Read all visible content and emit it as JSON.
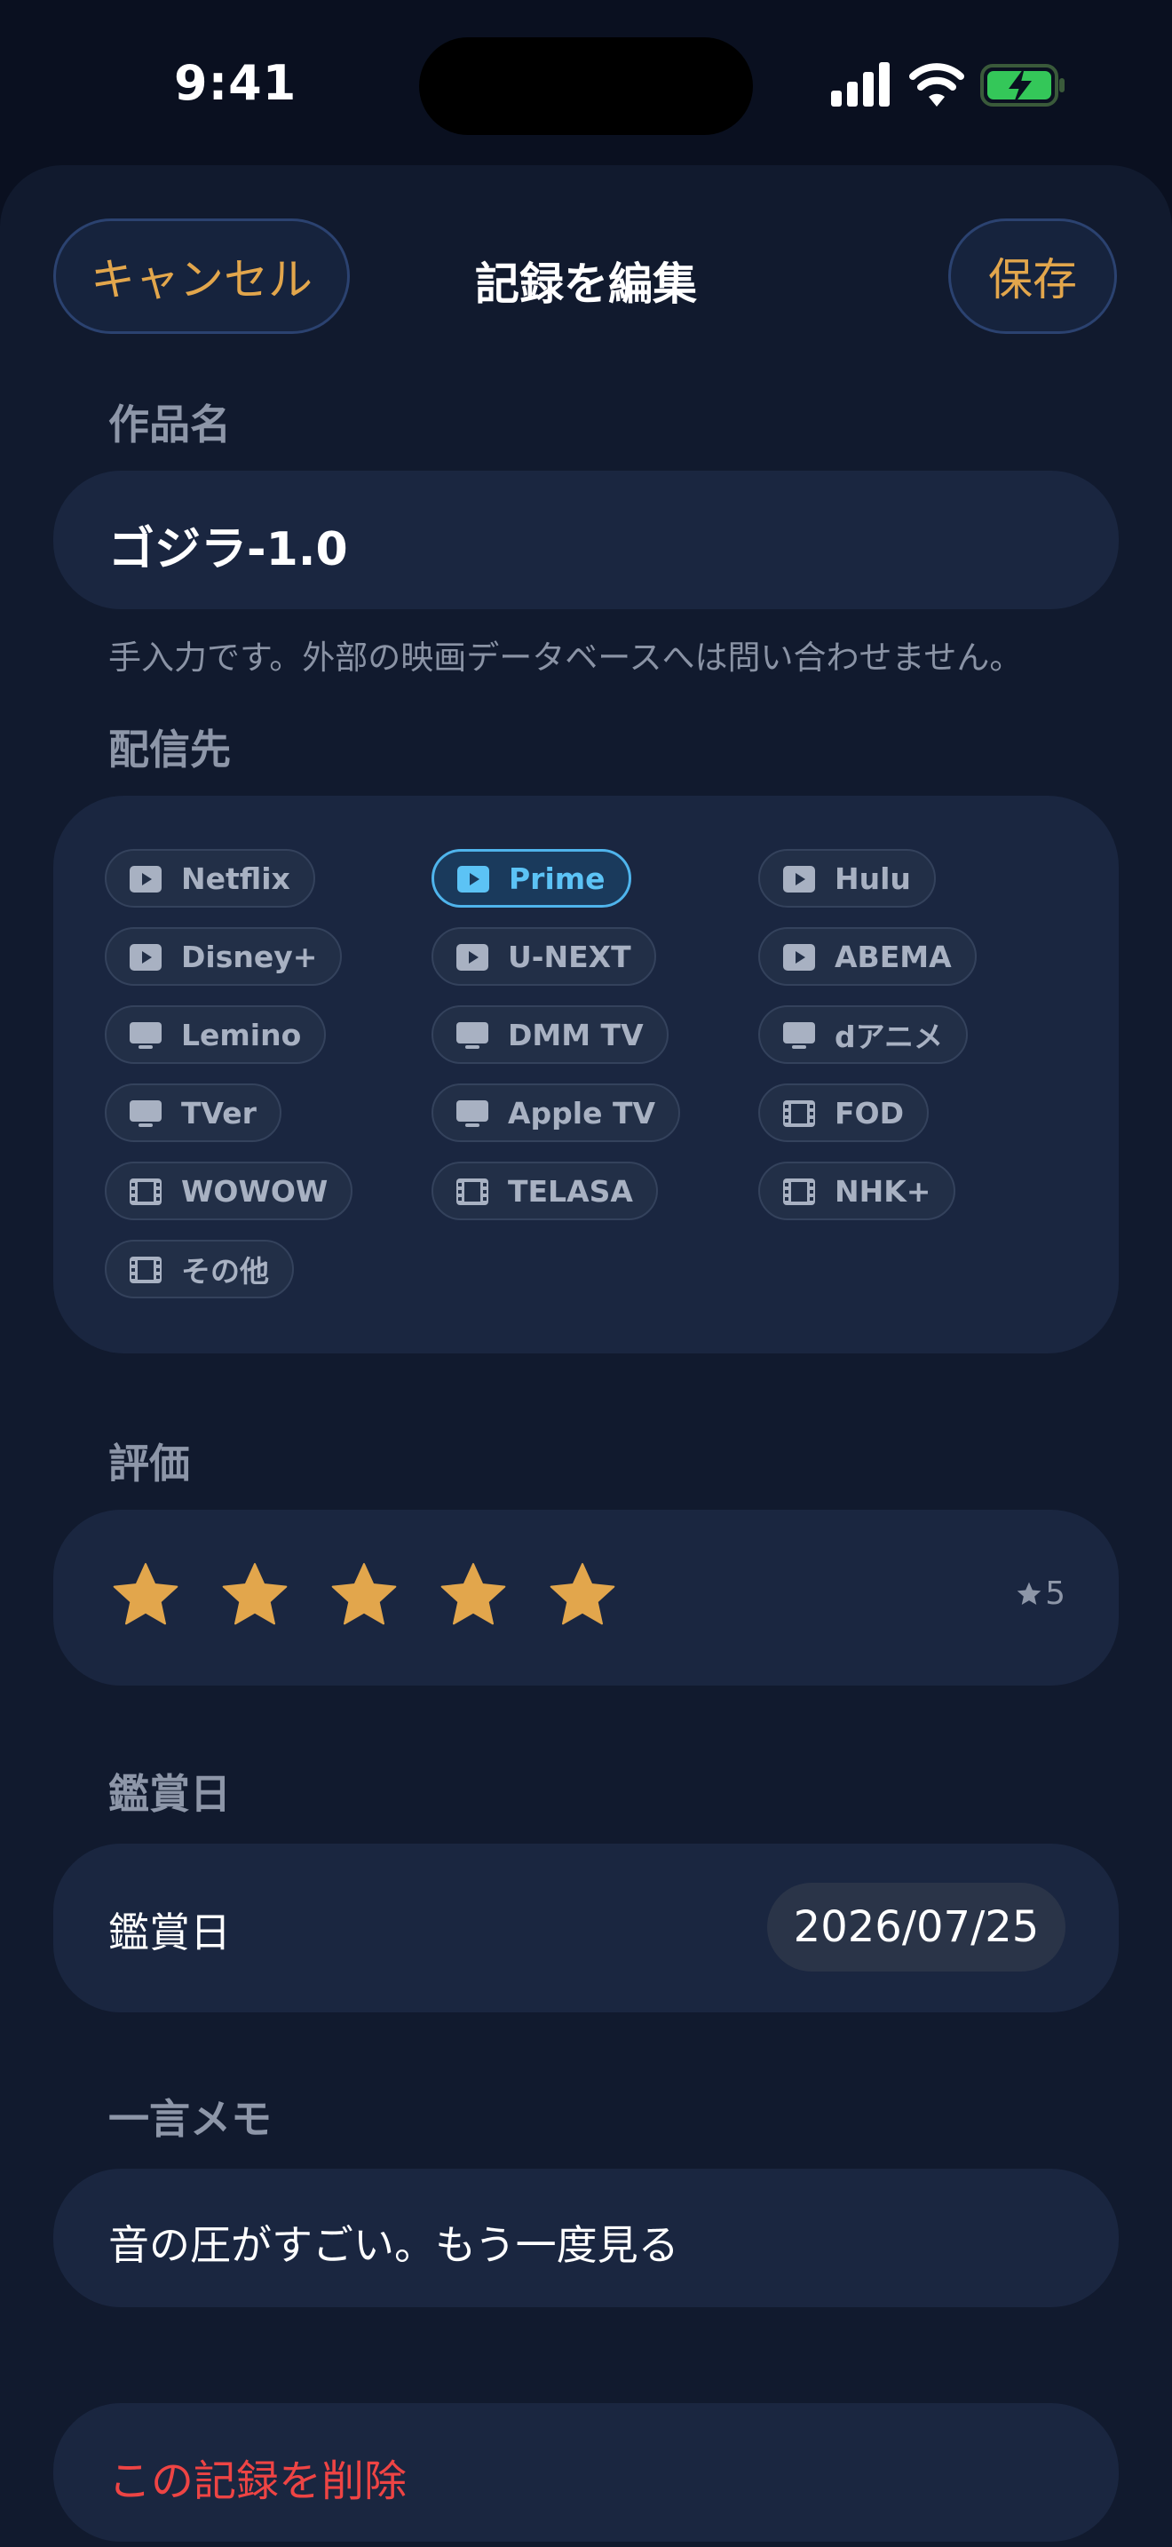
{
  "status_bar": {
    "time": "9:41"
  },
  "header": {
    "cancel_label": "キャンセル",
    "title": "記録を編集",
    "save_label": "保存"
  },
  "title_section": {
    "label": "作品名",
    "value": "ゴジラ-1.0",
    "hint": "手入力です。外部の映画データベースへは問い合わせません。"
  },
  "services": {
    "label": "配信先",
    "selected": "Prime",
    "items": [
      {
        "label": "Netflix",
        "icon": "play-icon"
      },
      {
        "label": "Prime",
        "icon": "play-icon"
      },
      {
        "label": "Hulu",
        "icon": "play-icon"
      },
      {
        "label": "Disney+",
        "icon": "play-icon"
      },
      {
        "label": "U-NEXT",
        "icon": "play-icon"
      },
      {
        "label": "ABEMA",
        "icon": "play-icon"
      },
      {
        "label": "Lemino",
        "icon": "tv-icon"
      },
      {
        "label": "DMM TV",
        "icon": "tv-icon"
      },
      {
        "label": "dアニメ",
        "icon": "tv-icon"
      },
      {
        "label": "TVer",
        "icon": "tv-icon"
      },
      {
        "label": "Apple TV",
        "icon": "tv-icon"
      },
      {
        "label": "FOD",
        "icon": "film-icon"
      },
      {
        "label": "WOWOW",
        "icon": "film-icon"
      },
      {
        "label": "TELASA",
        "icon": "film-icon"
      },
      {
        "label": "NHK+",
        "icon": "film-icon"
      },
      {
        "label": "その他",
        "icon": "film-icon"
      }
    ]
  },
  "rating": {
    "label": "評価",
    "value": 5,
    "max": 5,
    "display": "5",
    "star_color": "#e2a64c"
  },
  "watch_date": {
    "section_label": "鑑賞日",
    "row_label": "鑑賞日",
    "value": "2026/07/25"
  },
  "memo": {
    "label": "一言メモ",
    "value": "音の圧がすごい。もう一度見る"
  },
  "delete": {
    "label": "この記録を削除",
    "color": "#ee4444"
  },
  "colors": {
    "accent": "#e2a64c",
    "selected_chip": "#4fb4ec",
    "background": "#111a2e",
    "card": "#1a2640"
  }
}
